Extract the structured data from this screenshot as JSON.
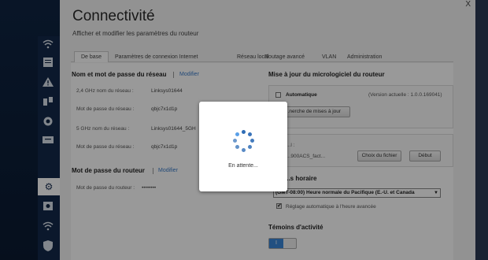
{
  "dialog": {
    "title": "Connectivité",
    "subtitle": "Afficher et modifier les paramètres du routeur",
    "close_label": "X"
  },
  "tabs": [
    {
      "label": "De base",
      "active": true
    },
    {
      "label": "Paramètres de connexion Internet",
      "active": false
    },
    {
      "label": "Réseau local",
      "active": false
    },
    {
      "label": "Routage avancé",
      "active": false
    },
    {
      "label": "VLAN",
      "active": false
    },
    {
      "label": "Administration",
      "active": false
    }
  ],
  "network": {
    "heading": "Nom et mot de passe du réseau",
    "modify": "Modifier",
    "rows": [
      {
        "label": "2,4 GHz nom du réseau :",
        "value": "Linksys01644"
      },
      {
        "label": "Mot de passe du réseau :",
        "value": "qbjc7x1d1p"
      },
      {
        "label": "5 GHz nom du réseau :",
        "value": "Linksys01644_5GH"
      },
      {
        "label": "Mot de passe du réseau :",
        "value": "qbjc7x1d1p"
      }
    ]
  },
  "router_password": {
    "heading": "Mot de passe du routeur",
    "modify": "Modifier",
    "label": "Mot de passe du routeur :",
    "value": "••••••••"
  },
  "firmware": {
    "heading": "Mise à jour du micrologiciel du routeur",
    "automatic": "Automatique",
    "version": "(Version actuelle : 1.0.0.169041)",
    "check_button": "...nerche de mises à jour",
    "manual_label": "...l :",
    "file_name": "...900ACS_fact...",
    "choose_button": "Choix du fichier",
    "start_button": "Début"
  },
  "timezone": {
    "heading": "...s horaire",
    "selected": "(GMT-08:00) Heure normale du Pacifique (E.-U. et Canada",
    "auto_label": "Réglage automatique à l'heure avancée",
    "auto_checked": true
  },
  "activity": {
    "heading": "Témoins d'activité",
    "toggle_label": "I"
  },
  "loading": {
    "text": "En attente..."
  },
  "colors": {
    "accent": "#3a7bc8",
    "spinner": "#2f6db6",
    "toggle_on": "#3a85d8"
  },
  "nav_icons": [
    "wifi-icon",
    "grid-icon",
    "warning-icon",
    "devices-icon",
    "globe-icon",
    "tv-icon",
    "gear-icon",
    "camera-icon",
    "wireless-icon",
    "shield-icon"
  ]
}
